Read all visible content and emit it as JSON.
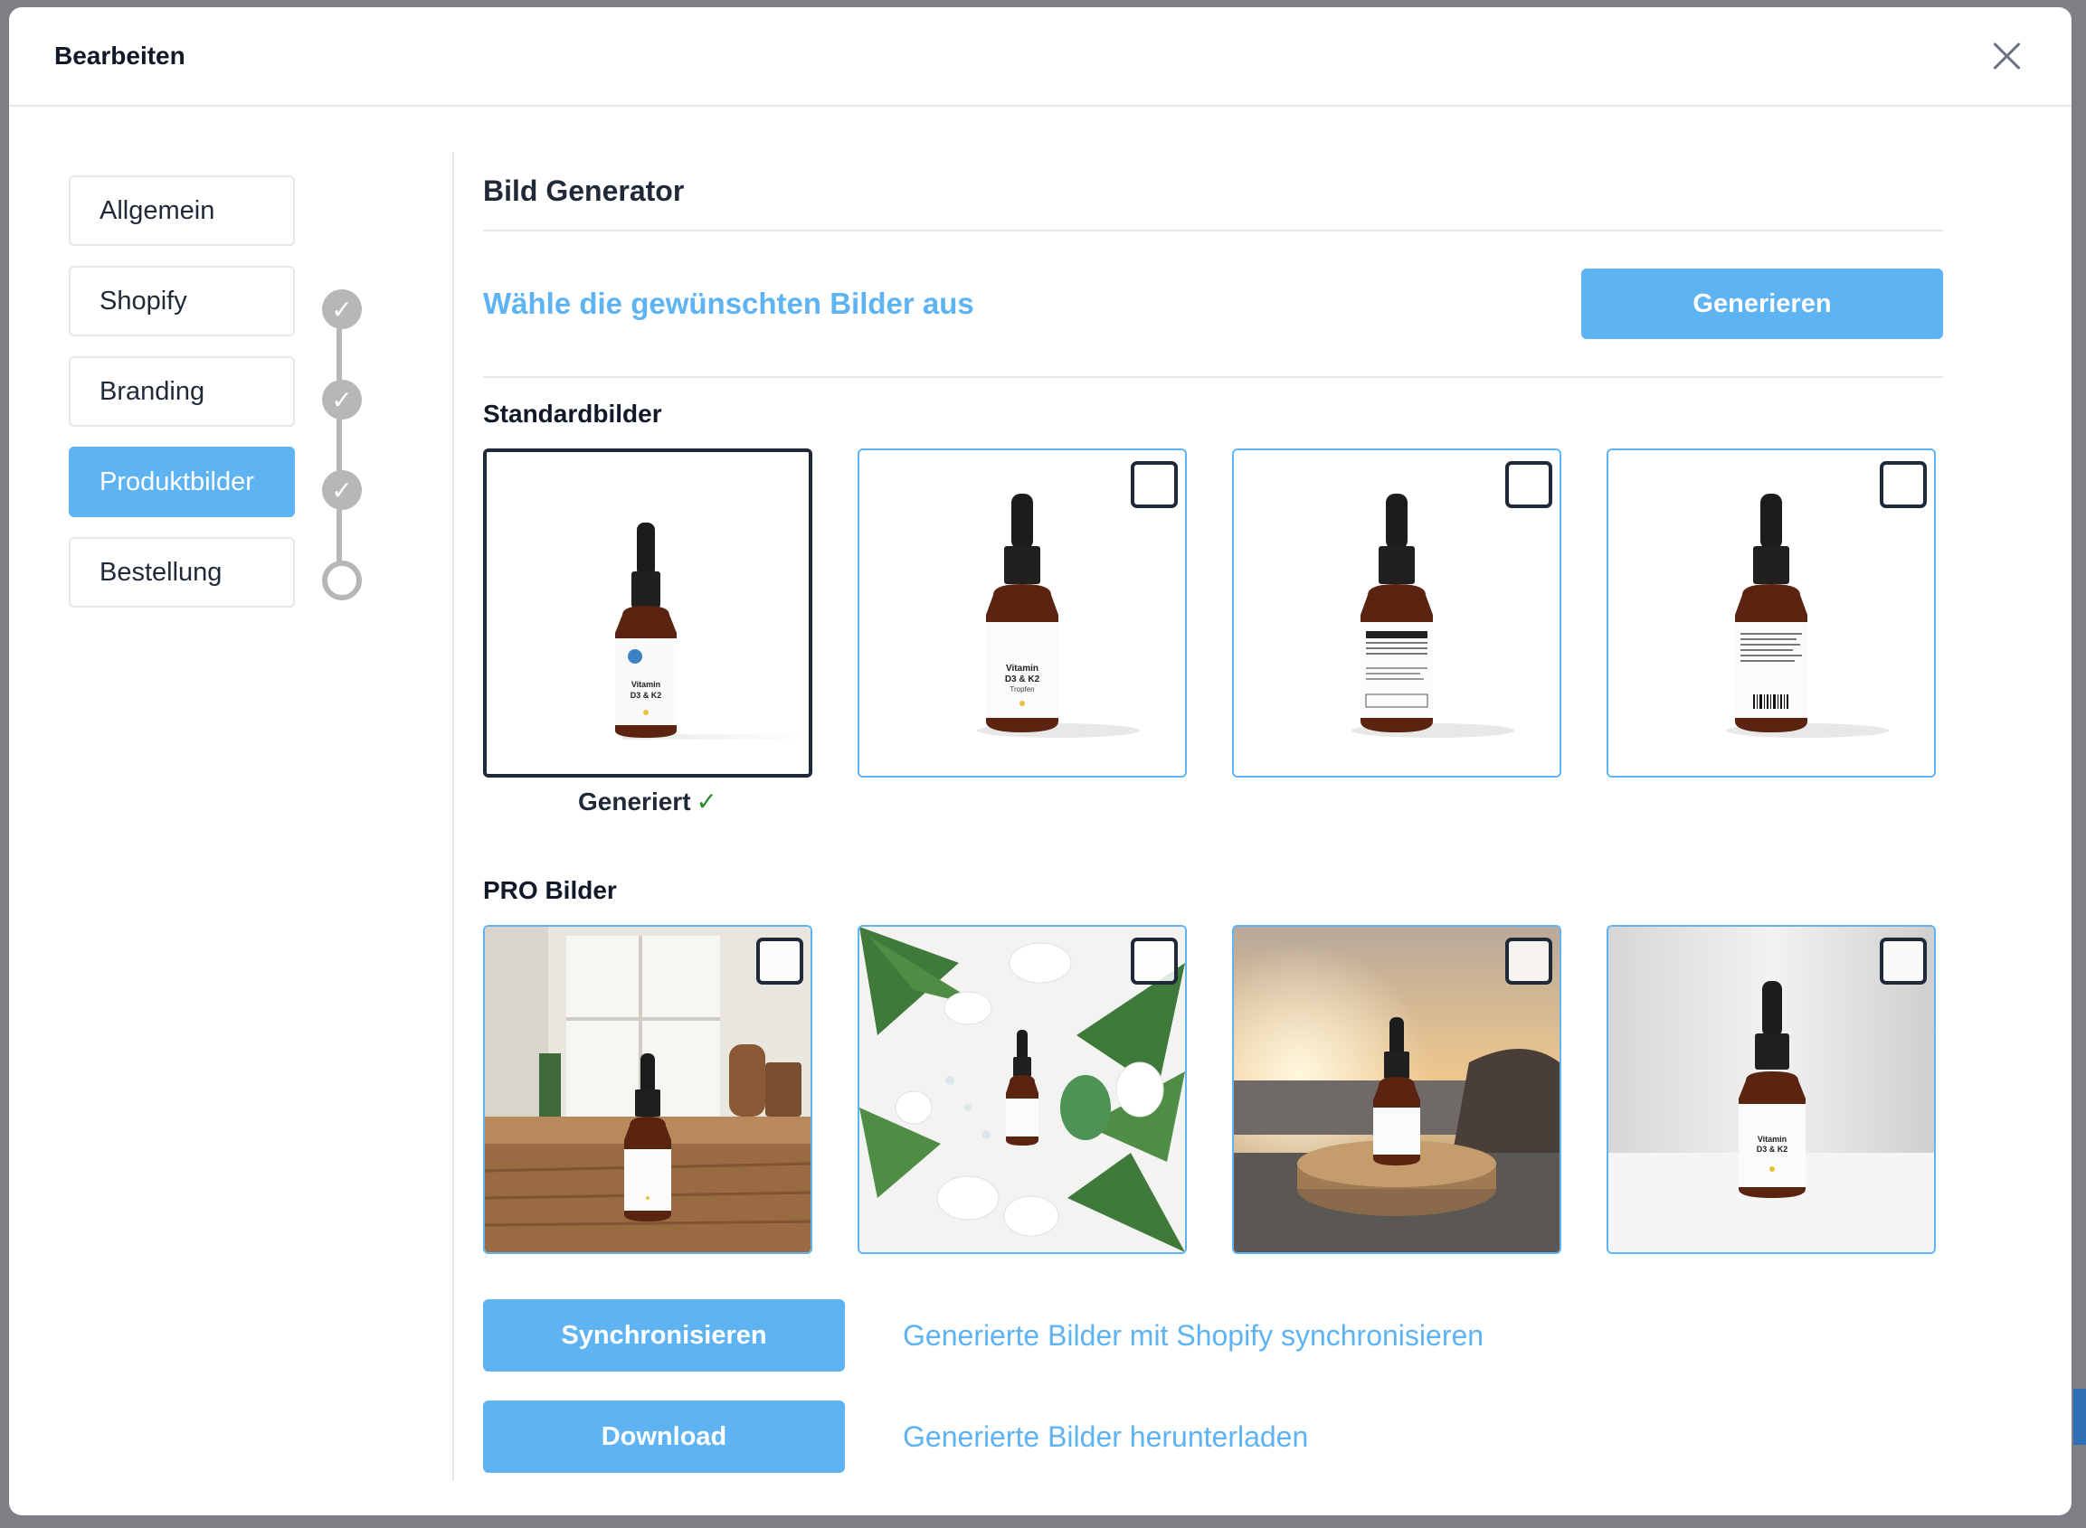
{
  "modal": {
    "title": "Bearbeiten"
  },
  "steps": [
    {
      "label": "Allgemein",
      "status": "none"
    },
    {
      "label": "Shopify",
      "status": "done"
    },
    {
      "label": "Branding",
      "status": "done"
    },
    {
      "label": "Produktbilder",
      "status": "done",
      "active": true
    },
    {
      "label": "Bestellung",
      "status": "pending"
    }
  ],
  "generator": {
    "title": "Bild Generator",
    "choose_text": "Wähle die gewünschten Bilder aus",
    "generate_label": "Generieren"
  },
  "standard": {
    "title": "Standardbilder",
    "generated_caption": "Generiert",
    "check_glyph": "✓",
    "bottle_label": "Vitamin D3 & K2",
    "bottle_sub": "Tropfen"
  },
  "pro": {
    "title": "PRO Bilder"
  },
  "actions": {
    "sync_label": "Synchronisieren",
    "sync_text": "Generierte Bilder mit Shopify synchronisieren",
    "download_label": "Download",
    "download_text": "Generierte Bilder herunterladen"
  },
  "colors": {
    "accent": "#5eb3f3",
    "dark": "#1f2937",
    "success": "#2e8b2e"
  }
}
